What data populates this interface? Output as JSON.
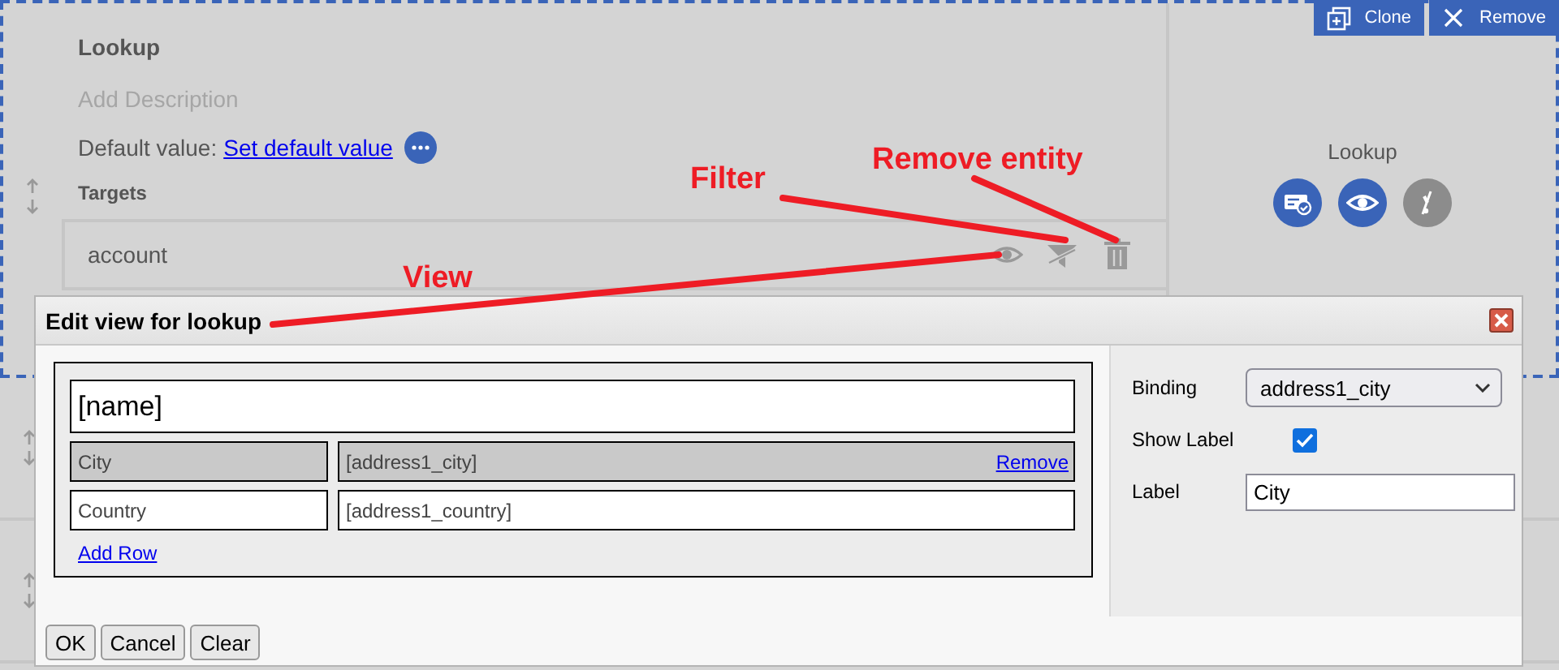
{
  "toolbar": {
    "buttons": [
      {
        "label": "Clone",
        "kind": "clone"
      },
      {
        "label": "Remove",
        "kind": "close"
      }
    ]
  },
  "field": {
    "title": "Lookup",
    "description_placeholder": "Add Description",
    "default_label": "Default value:",
    "default_link": "Set default value",
    "targets_heading": "Targets",
    "targets": [
      {
        "name": "account"
      }
    ]
  },
  "preview": {
    "label": "Lookup",
    "actions": [
      {
        "kind": "card",
        "enabled": true
      },
      {
        "kind": "view",
        "enabled": true
      },
      {
        "kind": "filter",
        "enabled": false
      }
    ]
  },
  "dialog": {
    "title": "Edit view for lookup",
    "header_field": "[name]",
    "rows": [
      {
        "label": "City",
        "binding": "[address1_city]",
        "selected": true,
        "action": "Remove"
      },
      {
        "label": "Country",
        "binding": "[address1_country]",
        "selected": false
      }
    ],
    "add_row": "Add Row",
    "properties": [
      {
        "kind": "select",
        "label": "Binding",
        "value": "address1_city"
      },
      {
        "kind": "checkbox",
        "label": "Show Label",
        "checked": true
      },
      {
        "kind": "text",
        "label": "Label",
        "value": "City"
      }
    ],
    "buttons": [
      "OK",
      "Cancel",
      "Clear"
    ]
  },
  "annotations": [
    {
      "text": "Filter"
    },
    {
      "text": "Remove entity"
    },
    {
      "text": "View"
    }
  ]
}
